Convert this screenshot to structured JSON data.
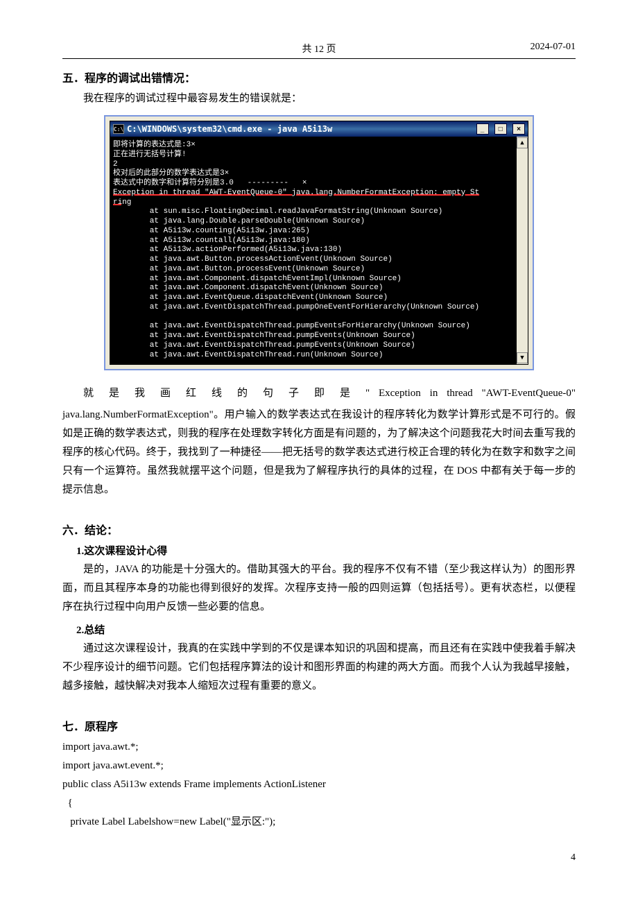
{
  "header": {
    "center": "共 12 页",
    "right": "2024-07-01"
  },
  "section5": {
    "title": "五．程序的调试出错情况：",
    "intro": "我在程序的调试过程中最容易发生的错误就是："
  },
  "cmd": {
    "title": "C:\\WINDOWS\\system32\\cmd.exe - java A5i13w",
    "line_expr_prefix": "即将计算的表达式是:3×",
    "line_calc": "正在进行无括号计算!",
    "line_2": "2",
    "line_checked_prefix": "校对后的此部分的数学表达式是3×",
    "line_numsops": "表达式中的数字和计算符分别是3.0   ---------   ×",
    "line_exc1": "Exception in thread \"AWT-EventQueue-0\" java.lang.NumberFormatException: empty St",
    "line_exc2": "ring",
    "trace": [
      "        at sun.misc.FloatingDecimal.readJavaFormatString(Unknown Source)",
      "        at java.lang.Double.parseDouble(Unknown Source)",
      "        at A5i13w.counting(A5i13w.java:265)",
      "        at A5i13w.countall(A5i13w.java:180)",
      "        at A5i13w.actionPerformed(A5i13w.java:130)",
      "        at java.awt.Button.processActionEvent(Unknown Source)",
      "        at java.awt.Button.processEvent(Unknown Source)",
      "        at java.awt.Component.dispatchEventImpl(Unknown Source)",
      "        at java.awt.Component.dispatchEvent(Unknown Source)",
      "        at java.awt.EventQueue.dispatchEvent(Unknown Source)",
      "        at java.awt.EventDispatchThread.pumpOneEventForHierarchy(Unknown Source)",
      "",
      "        at java.awt.EventDispatchThread.pumpEventsForHierarchy(Unknown Source)",
      "        at java.awt.EventDispatchThread.pumpEvents(Unknown Source)",
      "        at java.awt.EventDispatchThread.pumpEvents(Unknown Source)",
      "        at java.awt.EventDispatchThread.run(Unknown Source)"
    ]
  },
  "section5_explain": {
    "p1_a": "就 是 我 画 红 线 的 句 子 即 是 \" Exception  in  thread  \"AWT-EventQueue-0\"",
    "p1_b": "java.lang.NumberFormatException\"。用户输入的数学表达式在我设计的程序转化为数学计算形式是不可行的。假如是正确的数学表达式，则我的程序在处理数字转化方面是有问题的，为了解决这个问题我花大时间去重写我的程序的核心代码。终于，我找到了一种捷径——把无括号的数学表达式进行校正合理的转化为在数字和数字之间只有一个运算符。虽然我就摆平这个问题，但是我为了解程序执行的具体的过程，在 DOS 中都有关于每一步的提示信息。"
  },
  "section6": {
    "title": "六．结论：",
    "sub1_title": "1.这次课程设计心得",
    "sub1_p1": "是的，JAVA 的功能是十分强大的。借助其强大的平台。我的程序不仅有不错（至少我这样认为）的图形界面，而且其程序本身的功能也得到很好的发挥。次程序支持一般的四则运算（包括括号）。更有状态栏，以便程序在执行过程中向用户反馈一些必要的信息。",
    "sub2_title": "2.总结",
    "sub2_p1": "通过这次课程设计，我真的在实践中学到的不仅是课本知识的巩固和提高，而且还有在实践中使我着手解决不少程序设计的细节问题。它们包括程序算法的设计和图形界面的构建的两大方面。而我个人认为我越早接触，越多接触，越快解决对我本人缩短次过程有重要的意义。"
  },
  "section7": {
    "title": "七．原程序",
    "code": {
      "l1": "import java.awt.*;",
      "l2": "import java.awt.event.*;",
      "l3": "public class A5i13w extends Frame implements ActionListener",
      "l4": "  {",
      "l5": "   private Label Labelshow=new Label(\"显示区:\");"
    }
  },
  "page_num": "4",
  "icons": {
    "cmd": "C:\\",
    "min": "_",
    "max": "□",
    "close": "×",
    "up": "▲",
    "down": "▼"
  }
}
